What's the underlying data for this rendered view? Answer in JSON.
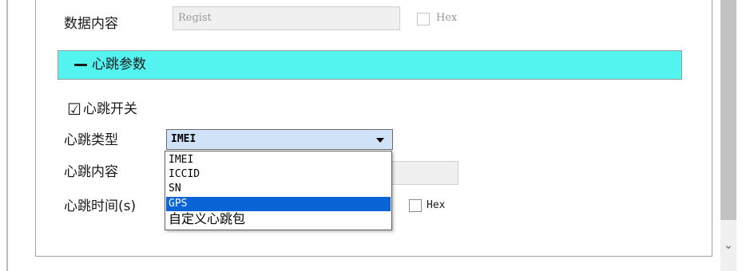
{
  "data_row": {
    "label": "数据内容",
    "input_value": "Regist",
    "hex_label": "Hex"
  },
  "heartbeat_section": {
    "collapse_symbol": "—",
    "title": "心跳参数"
  },
  "heartbeat_switch": {
    "checked_mark": "☑",
    "label": "心跳开关"
  },
  "heartbeat_type": {
    "label": "心跳类型",
    "selected_value": "IMEI",
    "options": [
      "IMEI",
      "ICCID",
      "SN",
      "GPS",
      "自定义心跳包"
    ],
    "highlighted_option": "GPS"
  },
  "heartbeat_content": {
    "label": "心跳内容"
  },
  "heartbeat_time": {
    "label": "心跳时间(s)",
    "hex_label": "Hex"
  },
  "scrollbar": {
    "down_arrow": "⌄"
  },
  "colors": {
    "section_header_bg": "#53f4ef",
    "combo_bg": "#cfe2f7",
    "selection_bg": "#0a64d6"
  }
}
